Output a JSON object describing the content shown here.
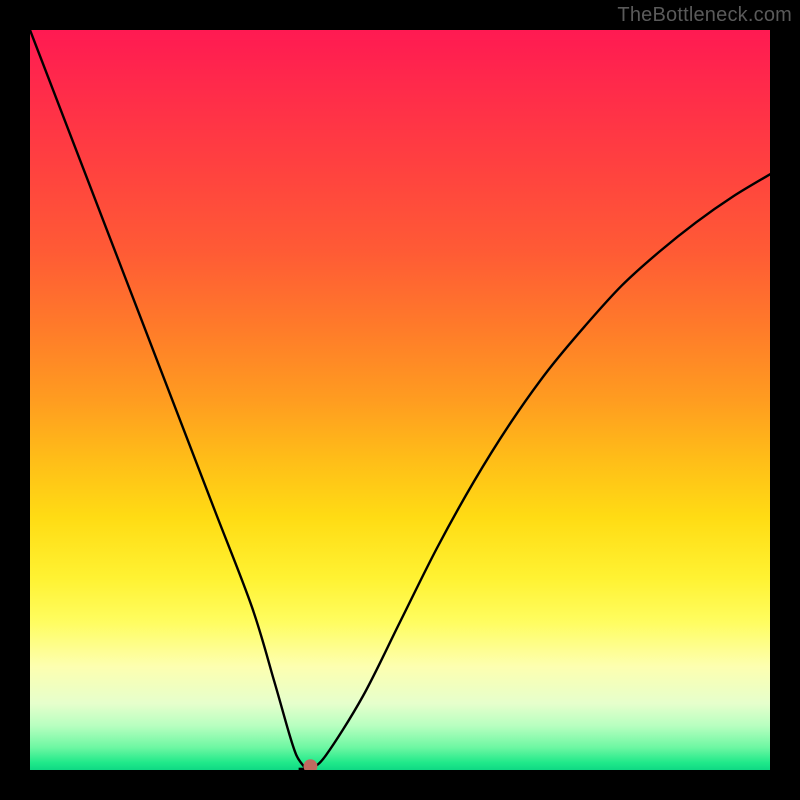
{
  "attribution": "TheBottleneck.com",
  "chart_data": {
    "type": "line",
    "title": "",
    "xlabel": "",
    "ylabel": "",
    "xlim": [
      0,
      100
    ],
    "ylim": [
      0,
      100
    ],
    "series": [
      {
        "name": "curve",
        "x": [
          0,
          5,
          10,
          15,
          20,
          25,
          30,
          33,
          35,
          36,
          37,
          37.5,
          38,
          40,
          45,
          50,
          55,
          60,
          65,
          70,
          75,
          80,
          85,
          90,
          95,
          100
        ],
        "y": [
          100,
          87,
          74,
          61,
          48,
          35,
          22,
          12,
          5,
          2,
          0.5,
          0,
          0.2,
          2,
          10,
          20,
          30,
          39,
          47,
          54,
          60,
          65.5,
          70,
          74,
          77.5,
          80.5
        ]
      }
    ],
    "marker": {
      "x": 37.9,
      "y": 0.5,
      "color": "#c06a60",
      "radius_px": 7
    },
    "gradient_stops": [
      {
        "pos": 0.0,
        "color": "#ff1a52"
      },
      {
        "pos": 0.3,
        "color": "#ff5b35"
      },
      {
        "pos": 0.58,
        "color": "#ffbd18"
      },
      {
        "pos": 0.8,
        "color": "#fffd60"
      },
      {
        "pos": 0.94,
        "color": "#b8ffc0"
      },
      {
        "pos": 1.0,
        "color": "#0fd984"
      }
    ],
    "grid": false,
    "legend": false
  }
}
